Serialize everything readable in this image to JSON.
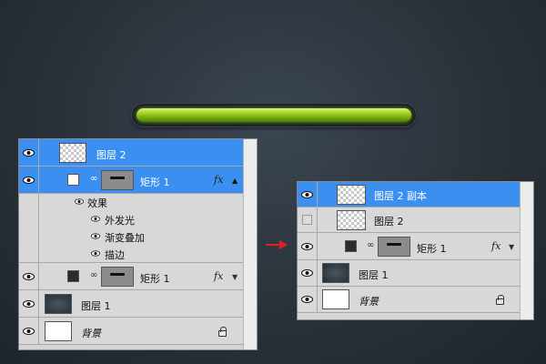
{
  "left_panel": {
    "rows": [
      {
        "label": "图层 2"
      },
      {
        "label": "矩形 1",
        "fx": "fx"
      },
      {
        "label": "效果"
      },
      {
        "label": "外发光"
      },
      {
        "label": "渐变叠加"
      },
      {
        "label": "描边"
      },
      {
        "label": "矩形 1",
        "fx": "fx"
      },
      {
        "label": "图层 1"
      },
      {
        "label": "背景"
      }
    ]
  },
  "right_panel": {
    "rows": [
      {
        "label": "图层 2 副本"
      },
      {
        "label": "图层 2"
      },
      {
        "label": "矩形 1",
        "fx": "fx"
      },
      {
        "label": "图层 1"
      },
      {
        "label": "背景"
      }
    ]
  },
  "colors": {
    "selection": "#3a8ff0",
    "arrow": "#e02020",
    "bar": "#8cc21c"
  }
}
